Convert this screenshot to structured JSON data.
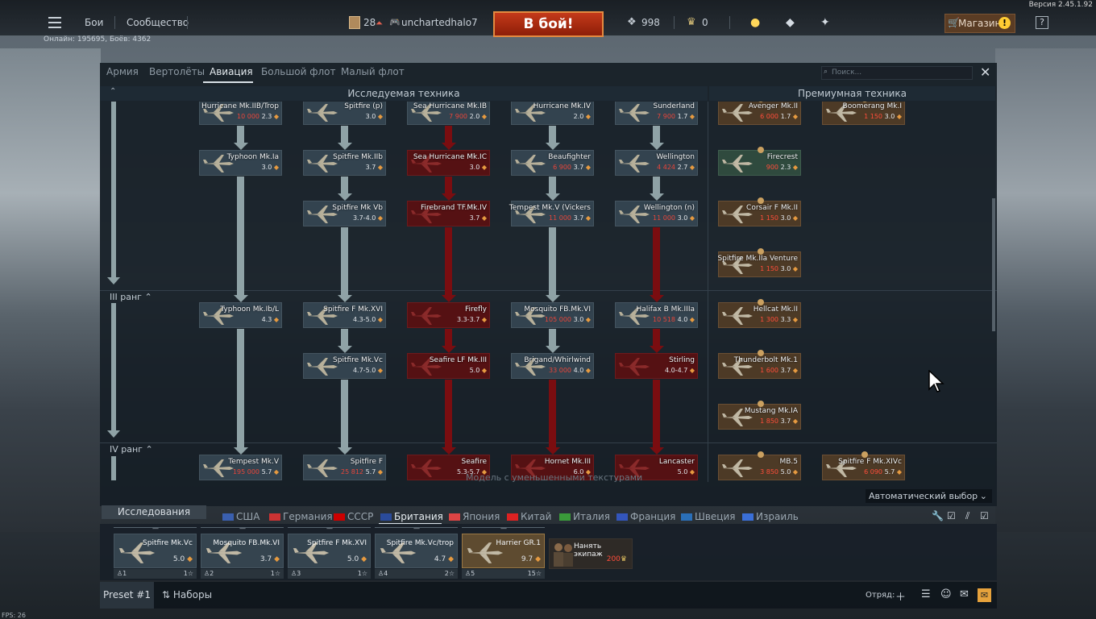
{
  "version": "Версия 2.45.1.92",
  "topbar": {
    "battles": "Бои",
    "community": "Сообщество",
    "online": "Онлайн: 195695, Боёв: 4362",
    "rank": "28",
    "username": "unchartedhalo7",
    "battle_button": "В бой!",
    "silver": "998",
    "eagles": "0",
    "shop": "Магазин"
  },
  "categories": [
    "Армия",
    "Вертолёты",
    "Авиация",
    "Большой флот",
    "Малый флот"
  ],
  "search_placeholder": "Поиск...",
  "headers": {
    "researchable": "Исследуемая техника",
    "premium": "Премиумная техника"
  },
  "ranks": {
    "r3": "III ранг",
    "r4": "IV ранг"
  },
  "tree": [
    {
      "name": "Hurricane Mk.IIB/Trop",
      "info": "10 000",
      "br": "2.3",
      "style": "default"
    },
    {
      "name": "Spitfire (p)",
      "info": "",
      "br": "3.0",
      "style": "default"
    },
    {
      "name": "Sea Hurricane Mk.IB",
      "info": "7 900",
      "br": "2.0",
      "style": "default"
    },
    {
      "name": "Hurricane Mk.IV",
      "info": "",
      "br": "2.0",
      "style": "default"
    },
    {
      "name": "Sunderland",
      "info": "7 900",
      "br": "1.7",
      "style": "default"
    },
    {
      "name": "Typhoon Mk.Ia",
      "info": "",
      "br": "3.0",
      "style": "default"
    },
    {
      "name": "Spitfire Mk.IIb",
      "info": "",
      "br": "3.7",
      "style": "default"
    },
    {
      "name": "Sea Hurricane Mk.IC",
      "info": "",
      "br": "3.0",
      "style": "red"
    },
    {
      "name": "Beaufighter",
      "info": "6 900",
      "br": "3.7",
      "style": "default"
    },
    {
      "name": "Wellington",
      "info": "4 424",
      "br": "2.7",
      "style": "default"
    },
    {
      "name": "Spitfire Mk Vb",
      "info": "",
      "br": "3.7-4.0",
      "style": "default"
    },
    {
      "name": "Firebrand TF.Mk.IV",
      "info": "",
      "br": "3.7",
      "style": "red"
    },
    {
      "name": "Tempest Mk.V (Vickers",
      "info": "11 000",
      "br": "3.7",
      "style": "default"
    },
    {
      "name": "Wellington (n)",
      "info": "11 000",
      "br": "3.0",
      "style": "default"
    },
    {
      "name": "Typhoon Mk.Ib/L",
      "info": "",
      "br": "4.3",
      "style": "default"
    },
    {
      "name": "Spitfire F Mk.XVI",
      "info": "",
      "br": "4.3-5.0",
      "style": "default"
    },
    {
      "name": "Firefly",
      "info": "",
      "br": "3.3-3.7",
      "style": "red"
    },
    {
      "name": "Mosquito FB.Mk.VI",
      "info": "105 000",
      "br": "3.0",
      "style": "default"
    },
    {
      "name": "Halifax B Mk.IIIa",
      "info": "10 518",
      "br": "4.0",
      "style": "default"
    },
    {
      "name": "Spitfire Mk.Vc",
      "info": "",
      "br": "4.7-5.0",
      "style": "default"
    },
    {
      "name": "Seafire LF Mk.III",
      "info": "",
      "br": "5.0",
      "style": "red"
    },
    {
      "name": "Brigand/Whirlwind",
      "info": "33 000",
      "br": "4.0",
      "style": "default"
    },
    {
      "name": "Stirling",
      "info": "",
      "br": "4.0-4.7",
      "style": "red"
    },
    {
      "name": "Tempest Mk.V",
      "info": "195 000",
      "br": "5.7",
      "style": "default"
    },
    {
      "name": "Spitfire F",
      "info": "25 812",
      "br": "5.7",
      "style": "default"
    },
    {
      "name": "Seafire",
      "info": "",
      "br": "5.3-5.7",
      "style": "red"
    },
    {
      "name": "Hornet Mk.III",
      "info": "",
      "br": "6.0",
      "style": "red"
    },
    {
      "name": "Lancaster",
      "info": "",
      "br": "5.0",
      "style": "red"
    }
  ],
  "premium": [
    {
      "name": "Avenger Mk.II",
      "info": "6 000",
      "br": "1.7"
    },
    {
      "name": "Boomerang Mk.I",
      "info": "1 150",
      "br": "3.0"
    },
    {
      "name": "Firecrest",
      "info": "900",
      "br": "2.3"
    },
    {
      "name": "Corsair F Mk.II",
      "info": "1 150",
      "br": "3.0"
    },
    {
      "name": "Spitfire Mk.IIa Venture",
      "info": "1 150",
      "br": "3.0"
    },
    {
      "name": "Hellcat Mk.II",
      "info": "1 300",
      "br": "3.3"
    },
    {
      "name": "Thunderbolt Mk.1",
      "info": "1 600",
      "br": "3.7"
    },
    {
      "name": "Mustang Mk.IA",
      "info": "1 850",
      "br": "3.7"
    },
    {
      "name": "MB.5",
      "info": "3 850",
      "br": "5.0"
    },
    {
      "name": "Spitfire F Mk.XIVc",
      "info": "6 090",
      "br": "5.7"
    }
  ],
  "notice": "Модель с уменьшенными текстурами",
  "auto_select": "Автоматический выбор",
  "research_tab": "Исследования",
  "nations": [
    "США",
    "Германия",
    "СССР",
    "Британия",
    "Япония",
    "Китай",
    "Италия",
    "Франция",
    "Швеция",
    "Израиль"
  ],
  "nation_colors": [
    "#3a5fae",
    "#c33",
    "#c00",
    "#2a4b9a",
    "#d44",
    "#d22",
    "#3a9a3a",
    "#3355bb",
    "#2a6fb8",
    "#3a6fd8"
  ],
  "crew": [
    {
      "name": "Spitfire Mk.Vc",
      "br": "5.0",
      "slot": "1",
      "extra": "1"
    },
    {
      "name": "Mosquito FB.Mk.VI",
      "br": "3.7",
      "slot": "2",
      "extra": "1"
    },
    {
      "name": "Spitfire F Mk.XVI",
      "br": "5.0",
      "slot": "3",
      "extra": "1"
    },
    {
      "name": "Spitfire Mk.Vc/trop",
      "br": "4.7",
      "slot": "4",
      "extra": "2"
    },
    {
      "name": "Harrier GR.1",
      "br": "9.7",
      "slot": "5",
      "extra": "15"
    }
  ],
  "hire": {
    "name": "Нанять экипаж",
    "cost": "200"
  },
  "bottom": {
    "preset": "Preset #1",
    "sets": "Наборы",
    "squad": "Отряд:"
  },
  "fps": "FPS: 26"
}
